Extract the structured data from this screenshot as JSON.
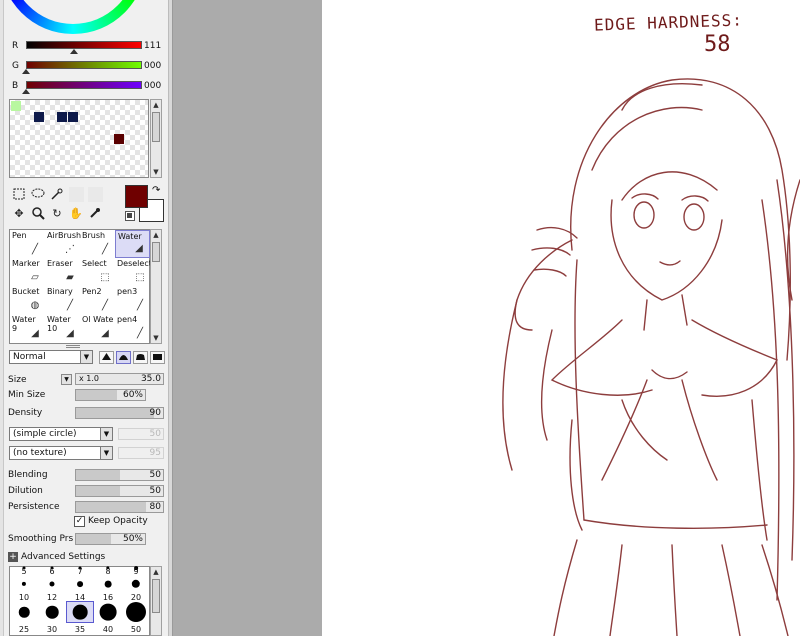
{
  "colors": {
    "accent": "#6f0000",
    "line_art": "#7a1c1c",
    "selection": "#dcdcf6",
    "panel_bg": "#f0f0f0"
  },
  "rgb": {
    "r_label": "R",
    "r_value": "111",
    "g_label": "G",
    "g_value": "000",
    "b_label": "B",
    "b_value": "000"
  },
  "palette_swatches": [
    {
      "color": "#b8f7a0"
    },
    {
      "color": "#0e1a4a"
    },
    {
      "color": "#0e1a4a"
    },
    {
      "color": "#0e1a4a"
    },
    {
      "color": "#5a0000"
    }
  ],
  "tools": {
    "selection_icons": [
      "rect-select-icon",
      "lasso-icon",
      "magic-wand-icon"
    ],
    "nav_icons": [
      "move-icon",
      "zoom-icon",
      "rotate-icon",
      "hand-icon",
      "eyedropper-icon"
    ]
  },
  "brushes": [
    {
      "name": "Pen",
      "icon": "pen-icon"
    },
    {
      "name": "AirBrush",
      "icon": "airbrush-icon"
    },
    {
      "name": "Brush",
      "icon": "brush-icon"
    },
    {
      "name": "Water",
      "icon": "water-icon",
      "selected": true
    },
    {
      "name": "Marker",
      "icon": "marker-icon"
    },
    {
      "name": "Eraser",
      "icon": "eraser-icon"
    },
    {
      "name": "Select",
      "icon": "select-icon"
    },
    {
      "name": "Deselect",
      "icon": "deselect-icon"
    },
    {
      "name": "Bucket",
      "icon": "bucket-icon"
    },
    {
      "name": "Binary",
      "icon": "binary-icon"
    },
    {
      "name": "Pen2",
      "icon": "pen-icon"
    },
    {
      "name": "pen3",
      "icon": "pen-icon"
    },
    {
      "name": "Water\n9",
      "icon": "water-icon"
    },
    {
      "name": "Water\n10",
      "icon": "water-icon"
    },
    {
      "name": "Ol Wate",
      "icon": "water-icon"
    },
    {
      "name": "pen4",
      "icon": "pen-icon"
    }
  ],
  "blend_mode": "Normal",
  "size": {
    "label": "Size",
    "multiplier": "x 1.0",
    "value": "35.0"
  },
  "min_size": {
    "label": "Min Size",
    "value": "60%",
    "level": 0.6
  },
  "density": {
    "label": "Density",
    "value": "90",
    "level": 0.9
  },
  "brush_shape": "(simple circle)",
  "brush_shape_value": "50",
  "texture": "(no texture)",
  "texture_value": "95",
  "blending": {
    "label": "Blending",
    "value": "50",
    "level": 0.5
  },
  "dilution": {
    "label": "Dilution",
    "value": "50",
    "level": 0.5
  },
  "persistence": {
    "label": "Persistence",
    "value": "80",
    "level": 0.8
  },
  "keep_opacity": {
    "label": "Keep Opacity",
    "checked": true
  },
  "smoothing": {
    "label": "Smoothing Prs",
    "value": "50%",
    "level": 0.5
  },
  "advanced_settings": "Advanced Settings",
  "brush_sizes": {
    "row0": [
      "5",
      "6",
      "7",
      "8",
      "9"
    ],
    "row1": [
      "10",
      "12",
      "14",
      "16",
      "20"
    ],
    "row2": [
      "25",
      "30",
      "35",
      "40",
      "50"
    ],
    "selected": "35"
  },
  "canvas_note": {
    "line1": "EDGE HARDNESS:",
    "line2": "58"
  }
}
